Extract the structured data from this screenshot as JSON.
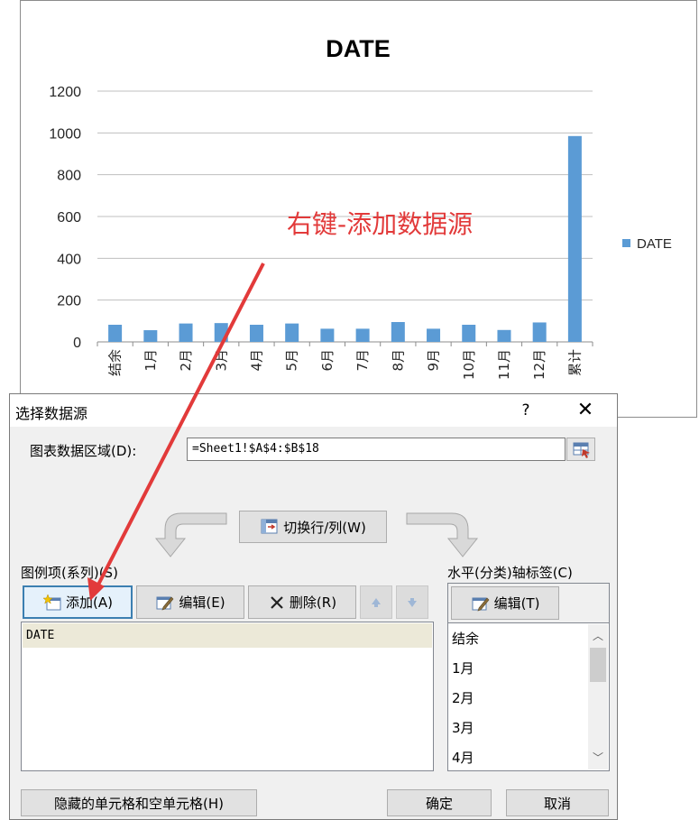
{
  "chart_data": {
    "type": "bar",
    "title": "DATE",
    "categories": [
      "结余",
      "1月",
      "2月",
      "3月",
      "4月",
      "5月",
      "6月",
      "7月",
      "8月",
      "9月",
      "10月",
      "11月",
      "12月",
      "累计"
    ],
    "series": [
      {
        "name": "DATE",
        "values": [
          82,
          56,
          88,
          90,
          82,
          88,
          63,
          63,
          95,
          63,
          82,
          57,
          93,
          985
        ],
        "color": "#5b9bd5"
      }
    ],
    "ylim": [
      0,
      1200
    ],
    "yticks": [
      0,
      200,
      400,
      600,
      800,
      1000,
      1200
    ],
    "legend": "right",
    "grid": true
  },
  "annotation": {
    "text": "右键-添加数据源",
    "color": "#e23a3a"
  },
  "dialog": {
    "title": "选择数据源",
    "help": "?",
    "close": "✕",
    "range_label": "图表数据区域(D):",
    "range_value": "=Sheet1!$A$4:$B$18",
    "switch_label": "切换行/列(W)",
    "legend_label": "图例项(系列)(S)",
    "axis_label": "水平(分类)轴标签(C)",
    "add_label": "添加(A)",
    "edit_label": "编辑(E)",
    "delete_label": "删除(R)",
    "axis_edit_label": "编辑(T)",
    "series_items": [
      "DATE"
    ],
    "category_items": [
      "结余",
      "1月",
      "2月",
      "3月",
      "4月"
    ],
    "hidden_cells_label": "隐藏的单元格和空单元格(H)",
    "ok_label": "确定",
    "cancel_label": "取消"
  }
}
